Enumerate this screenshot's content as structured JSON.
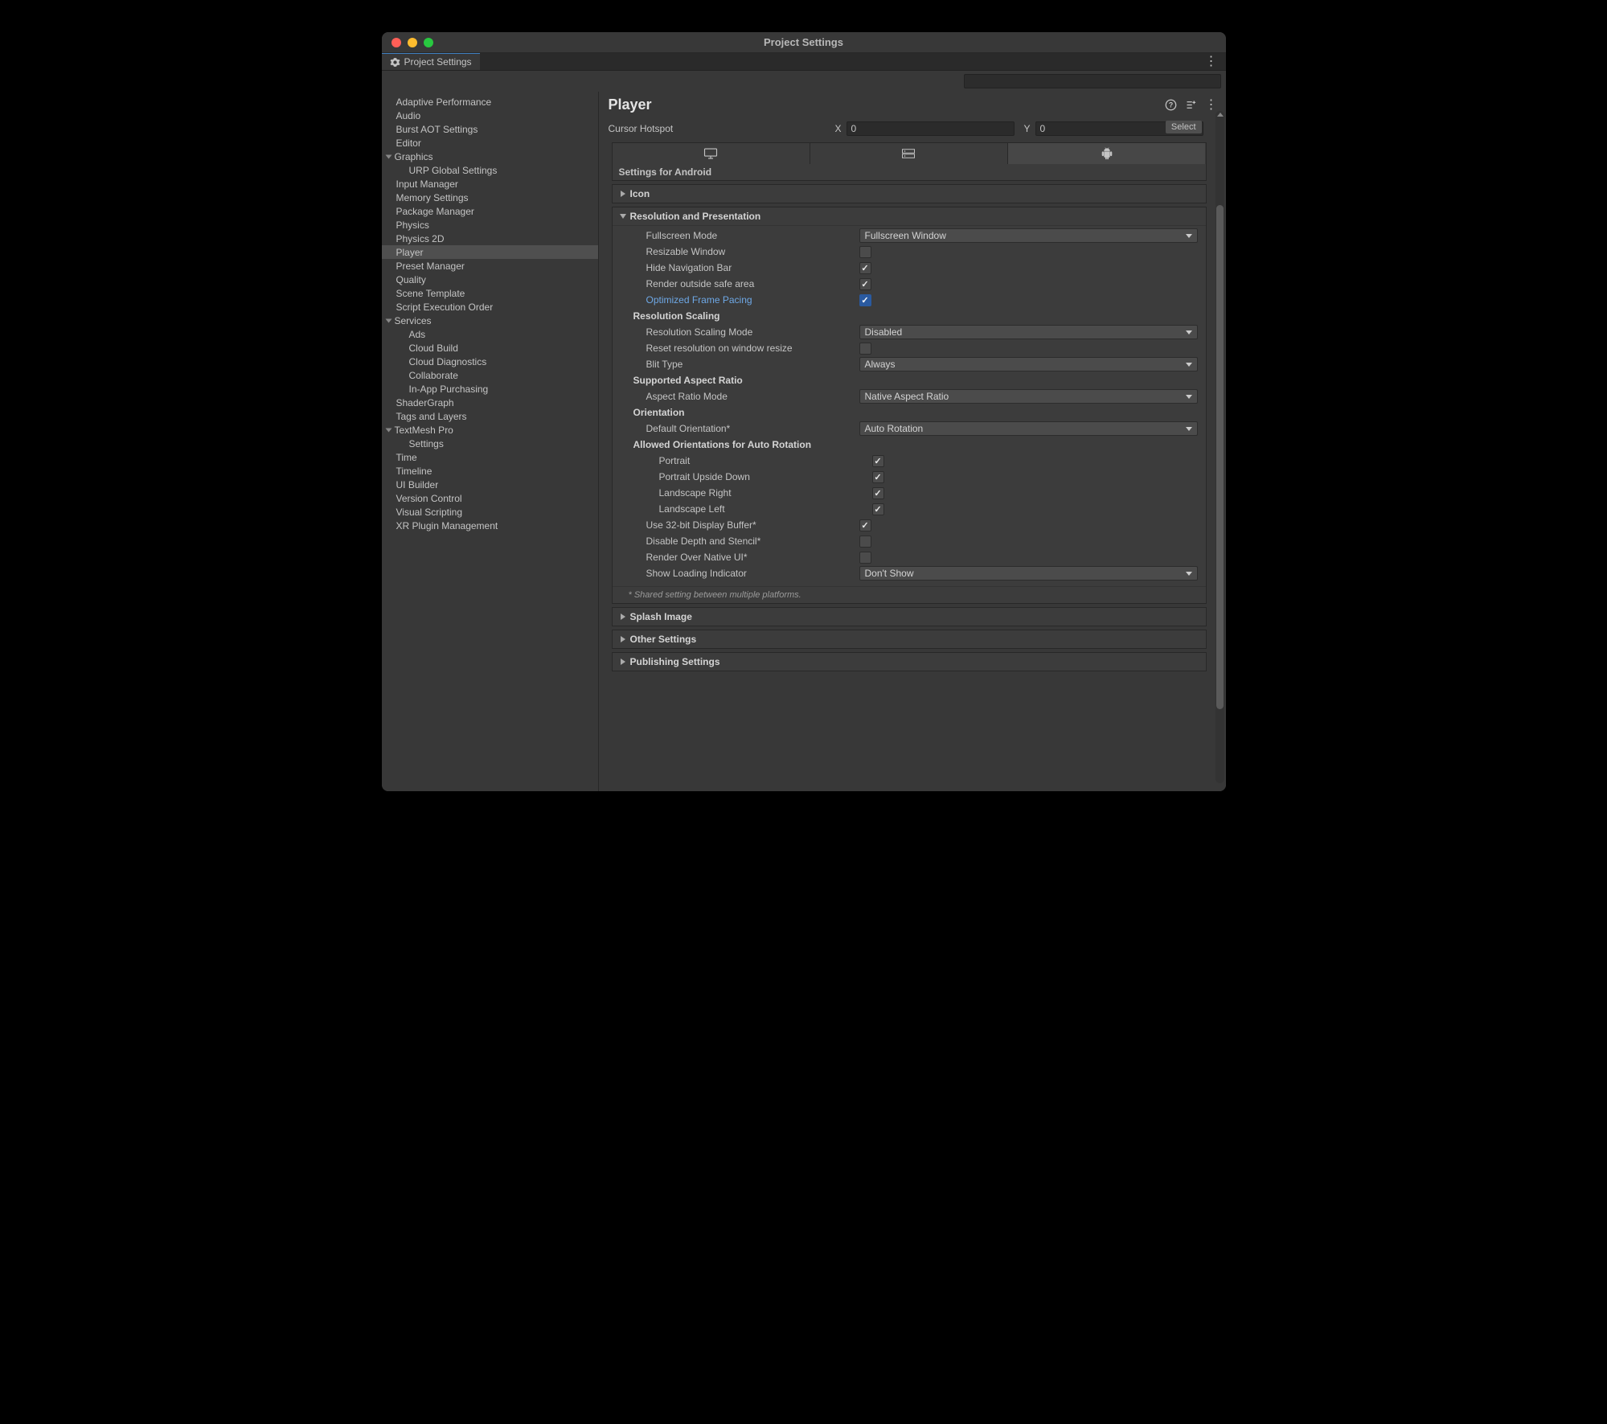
{
  "window": {
    "title": "Project Settings"
  },
  "tab": {
    "label": "Project Settings"
  },
  "search": {
    "placeholder": ""
  },
  "sidebar": {
    "items": [
      {
        "label": "Adaptive Performance",
        "indent": 0
      },
      {
        "label": "Audio",
        "indent": 0
      },
      {
        "label": "Burst AOT Settings",
        "indent": 0
      },
      {
        "label": "Editor",
        "indent": 0
      },
      {
        "label": "Graphics",
        "indent": 0,
        "expand": true
      },
      {
        "label": "URP Global Settings",
        "indent": 1
      },
      {
        "label": "Input Manager",
        "indent": 0
      },
      {
        "label": "Memory Settings",
        "indent": 0
      },
      {
        "label": "Package Manager",
        "indent": 0
      },
      {
        "label": "Physics",
        "indent": 0
      },
      {
        "label": "Physics 2D",
        "indent": 0
      },
      {
        "label": "Player",
        "indent": 0,
        "selected": true
      },
      {
        "label": "Preset Manager",
        "indent": 0
      },
      {
        "label": "Quality",
        "indent": 0
      },
      {
        "label": "Scene Template",
        "indent": 0
      },
      {
        "label": "Script Execution Order",
        "indent": 0
      },
      {
        "label": "Services",
        "indent": 0,
        "expand": true
      },
      {
        "label": "Ads",
        "indent": 1
      },
      {
        "label": "Cloud Build",
        "indent": 1
      },
      {
        "label": "Cloud Diagnostics",
        "indent": 1
      },
      {
        "label": "Collaborate",
        "indent": 1
      },
      {
        "label": "In-App Purchasing",
        "indent": 1
      },
      {
        "label": "ShaderGraph",
        "indent": 0
      },
      {
        "label": "Tags and Layers",
        "indent": 0
      },
      {
        "label": "TextMesh Pro",
        "indent": 0,
        "expand": true
      },
      {
        "label": "Settings",
        "indent": 1
      },
      {
        "label": "Time",
        "indent": 0
      },
      {
        "label": "Timeline",
        "indent": 0
      },
      {
        "label": "UI Builder",
        "indent": 0
      },
      {
        "label": "Version Control",
        "indent": 0
      },
      {
        "label": "Visual Scripting",
        "indent": 0
      },
      {
        "label": "XR Plugin Management",
        "indent": 0
      }
    ]
  },
  "main": {
    "title": "Player",
    "select_badge": "Select",
    "cursor_hotspot": {
      "label": "Cursor Hotspot",
      "xlabel": "X",
      "x": "0",
      "ylabel": "Y",
      "y": "0"
    },
    "section_title": "Settings for Android",
    "panels": {
      "icon": {
        "title": "Icon"
      },
      "resolution": {
        "title": "Resolution and Presentation",
        "fullscreen_mode": {
          "label": "Fullscreen Mode",
          "value": "Fullscreen Window"
        },
        "resizable_window": {
          "label": "Resizable Window",
          "checked": false
        },
        "hide_nav": {
          "label": "Hide Navigation Bar",
          "checked": true
        },
        "render_safe": {
          "label": "Render outside safe area",
          "checked": true
        },
        "frame_pacing": {
          "label": "Optimized Frame Pacing",
          "checked": true
        },
        "scaling_header": "Resolution Scaling",
        "scaling_mode": {
          "label": "Resolution Scaling Mode",
          "value": "Disabled"
        },
        "reset_res": {
          "label": "Reset resolution on window resize",
          "checked": false
        },
        "blit": {
          "label": "Blit Type",
          "value": "Always"
        },
        "aspect_header": "Supported Aspect Ratio",
        "aspect_mode": {
          "label": "Aspect Ratio Mode",
          "value": "Native Aspect Ratio"
        },
        "orient_header": "Orientation",
        "default_orient": {
          "label": "Default Orientation*",
          "value": "Auto Rotation"
        },
        "allowed_header": "Allowed Orientations for Auto Rotation",
        "portrait": {
          "label": "Portrait",
          "checked": true
        },
        "portrait_ud": {
          "label": "Portrait Upside Down",
          "checked": true
        },
        "landscape_r": {
          "label": "Landscape Right",
          "checked": true
        },
        "landscape_l": {
          "label": "Landscape Left",
          "checked": true
        },
        "use32": {
          "label": "Use 32-bit Display Buffer*",
          "checked": true
        },
        "disable_depth": {
          "label": "Disable Depth and Stencil*",
          "checked": false
        },
        "render_native": {
          "label": "Render Over Native UI*",
          "checked": false
        },
        "loading": {
          "label": "Show Loading Indicator",
          "value": "Don't Show"
        },
        "footnote": "* Shared setting between multiple platforms."
      },
      "splash": {
        "title": "Splash Image"
      },
      "other": {
        "title": "Other Settings"
      },
      "publish": {
        "title": "Publishing Settings"
      }
    }
  }
}
